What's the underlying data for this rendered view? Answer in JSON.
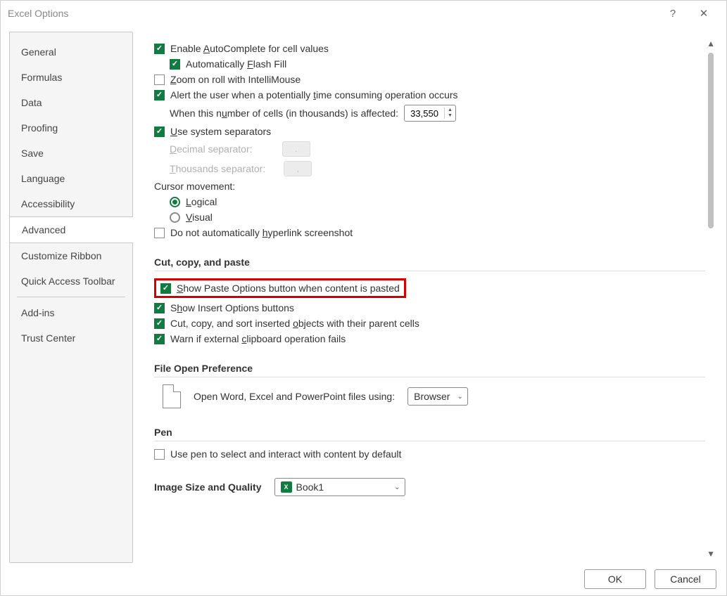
{
  "dialogTitle": "Excel Options",
  "sidebar": {
    "items": [
      {
        "label": "General"
      },
      {
        "label": "Formulas"
      },
      {
        "label": "Data"
      },
      {
        "label": "Proofing"
      },
      {
        "label": "Save"
      },
      {
        "label": "Language"
      },
      {
        "label": "Accessibility"
      },
      {
        "label": "Advanced",
        "selected": true
      },
      {
        "label": "Customize Ribbon"
      },
      {
        "label": "Quick Access Toolbar"
      },
      {
        "label": "Add-ins"
      },
      {
        "label": "Trust Center"
      }
    ]
  },
  "editing": {
    "enableAutoComplete_pre": "Enable ",
    "enableAutoComplete_u": "A",
    "enableAutoComplete_post": "utoComplete for cell values",
    "autoFlashFill_pre": "Automatically ",
    "autoFlashFill_u": "F",
    "autoFlashFill_post": "lash Fill",
    "zoom_pre": "",
    "zoom_u": "Z",
    "zoom_post": "oom on roll with IntelliMouse",
    "alert_pre": "Alert the user when a potentially ",
    "alert_u": "t",
    "alert_post": "ime consuming operation occurs",
    "whenCells_pre": "When this n",
    "whenCells_u": "u",
    "whenCells_post": "mber of cells (in thousands) is affected:",
    "cellsValue": "33,550",
    "useSep_pre": "",
    "useSep_u": "U",
    "useSep_post": "se system separators",
    "decSep_pre": "",
    "decSep_u": "D",
    "decSep_post": "ecimal separator:",
    "decSepValue": ".",
    "thouSep_pre": "",
    "thouSep_u": "T",
    "thouSep_post": "housands separator:",
    "thouSepValue": ",",
    "cursorMovement": "Cursor movement:",
    "logical_pre": "",
    "logical_u": "L",
    "logical_post": "ogical",
    "visual_pre": "",
    "visual_u": "V",
    "visual_post": "isual",
    "hyperlink_pre": "Do not automatically ",
    "hyperlink_u": "h",
    "hyperlink_post": "yperlink screenshot"
  },
  "sections": {
    "cutCopyPaste": "Cut, copy, and paste",
    "fileOpen": "File Open Preference",
    "pen": "Pen",
    "imageSize": "Image Size and Quality"
  },
  "ccp": {
    "showPaste_pre": "",
    "showPaste_u": "S",
    "showPaste_post": "how Paste Options button when content is pasted",
    "showInsert_pre": "S",
    "showInsert_u": "h",
    "showInsert_post": "ow Insert Options buttons",
    "cutCopySort_pre": "Cut, copy, and sort inserted ",
    "cutCopySort_u": "o",
    "cutCopySort_post": "bjects with their parent cells",
    "warnClip_pre": "Warn if external ",
    "warnClip_u": "c",
    "warnClip_post": "lipboard operation fails"
  },
  "fileOpen": {
    "label": "Open Word, Excel and PowerPoint files using:",
    "value": "Browser"
  },
  "pen": {
    "label": "Use pen to select and interact with content by default"
  },
  "imageSize": {
    "value": "Book1"
  },
  "buttons": {
    "ok": "OK",
    "cancel": "Cancel"
  }
}
